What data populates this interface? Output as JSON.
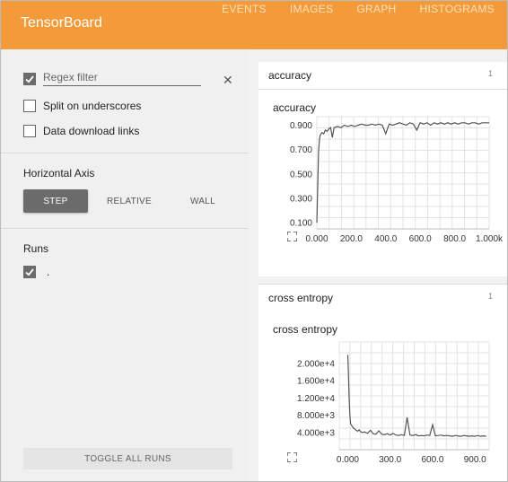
{
  "app": {
    "title": "TensorBoard"
  },
  "nav": {
    "tabs": [
      "EVENTS",
      "IMAGES",
      "GRAPH",
      "HISTOGRAMS"
    ]
  },
  "sidebar": {
    "regex_filter": {
      "checked": true,
      "placeholder": "Regex filter",
      "clear_icon": "close-icon"
    },
    "split_underscores": {
      "label": "Split on underscores",
      "checked": false
    },
    "data_download": {
      "label": "Data download links",
      "checked": false
    },
    "horizontal_axis": {
      "title": "Horizontal Axis",
      "options": [
        "STEP",
        "RELATIVE",
        "WALL"
      ],
      "selected": "STEP"
    },
    "runs": {
      "title": "Runs",
      "items": [
        {
          "name": ".",
          "checked": true
        }
      ]
    },
    "toggle_all_runs": "TOGGLE ALL RUNS"
  },
  "groups": [
    {
      "name": "accuracy",
      "count": "1",
      "chart_title": "accuracy"
    },
    {
      "name": "cross entropy",
      "count": "1",
      "chart_title": "cross entropy"
    }
  ],
  "chart_data": [
    {
      "type": "line",
      "title": "accuracy",
      "xlabel": "",
      "ylabel": "",
      "grid": true,
      "xlim": [
        0,
        1000
      ],
      "ylim": [
        0.05,
        0.97
      ],
      "x_ticks": [
        "0.000",
        "200.0",
        "400.0",
        "600.0",
        "800.0",
        "1.000k"
      ],
      "x_tick_values": [
        0,
        200,
        400,
        600,
        800,
        1000
      ],
      "y_ticks": [
        "0.100",
        "0.300",
        "0.500",
        "0.700",
        "0.900"
      ],
      "y_tick_values": [
        0.1,
        0.3,
        0.5,
        0.7,
        0.9
      ],
      "color": "#555555",
      "series": [
        {
          "x": [
            0,
            5,
            10,
            15,
            20,
            30,
            40,
            50,
            60,
            70,
            80,
            90,
            100,
            120,
            140,
            160,
            180,
            200,
            220,
            240,
            260,
            280,
            300,
            320,
            340,
            360,
            380,
            400,
            420,
            440,
            460,
            480,
            500,
            520,
            540,
            560,
            580,
            600,
            620,
            640,
            660,
            680,
            700,
            720,
            740,
            760,
            780,
            800,
            820,
            840,
            860,
            880,
            900,
            920,
            940,
            960,
            980,
            1000
          ],
          "y": [
            0.1,
            0.4,
            0.68,
            0.78,
            0.82,
            0.84,
            0.83,
            0.86,
            0.85,
            0.87,
            0.88,
            0.8,
            0.88,
            0.89,
            0.88,
            0.9,
            0.89,
            0.9,
            0.89,
            0.9,
            0.91,
            0.9,
            0.9,
            0.91,
            0.9,
            0.91,
            0.9,
            0.83,
            0.91,
            0.9,
            0.91,
            0.92,
            0.91,
            0.9,
            0.92,
            0.91,
            0.86,
            0.92,
            0.91,
            0.92,
            0.9,
            0.92,
            0.91,
            0.92,
            0.91,
            0.92,
            0.91,
            0.92,
            0.91,
            0.92,
            0.92,
            0.91,
            0.92,
            0.92,
            0.91,
            0.92,
            0.92,
            0.92
          ]
        }
      ]
    },
    {
      "type": "line",
      "title": "cross entropy",
      "xlabel": "",
      "ylabel": "",
      "grid": true,
      "xlim": [
        -60,
        1000
      ],
      "ylim": [
        0,
        25000
      ],
      "x_ticks": [
        "0.000",
        "300.0",
        "600.0",
        "900.0"
      ],
      "x_tick_values": [
        0,
        300,
        600,
        900
      ],
      "y_ticks": [
        "4.000e+3",
        "8.000e+3",
        "1.200e+4",
        "1.600e+4",
        "2.000e+4"
      ],
      "y_tick_values": [
        4000,
        8000,
        12000,
        16000,
        20000
      ],
      "color": "#555555",
      "series": [
        {
          "x": [
            0,
            5,
            10,
            15,
            20,
            30,
            40,
            50,
            60,
            70,
            80,
            90,
            100,
            120,
            140,
            160,
            180,
            200,
            220,
            240,
            260,
            280,
            300,
            320,
            340,
            360,
            380,
            400,
            420,
            440,
            460,
            480,
            500,
            520,
            540,
            560,
            580,
            600,
            620,
            640,
            660,
            680,
            700,
            720,
            740,
            760,
            780,
            800,
            820,
            840,
            860,
            880,
            900,
            920,
            940,
            960,
            980
          ],
          "y": [
            22000,
            18000,
            12000,
            8000,
            6000,
            5500,
            5000,
            4800,
            4500,
            4300,
            4600,
            4200,
            4000,
            4100,
            3800,
            4500,
            3700,
            3600,
            4400,
            3600,
            3500,
            3700,
            3400,
            3800,
            3400,
            3300,
            3500,
            3300,
            7500,
            3400,
            3300,
            3500,
            3200,
            3300,
            3200,
            3400,
            3300,
            5800,
            3200,
            3300,
            3400,
            3200,
            3300,
            3200,
            3100,
            3300,
            3200,
            3100,
            3300,
            3200,
            3100,
            3200,
            3100,
            3300,
            3100,
            3200,
            3100
          ]
        }
      ]
    }
  ]
}
